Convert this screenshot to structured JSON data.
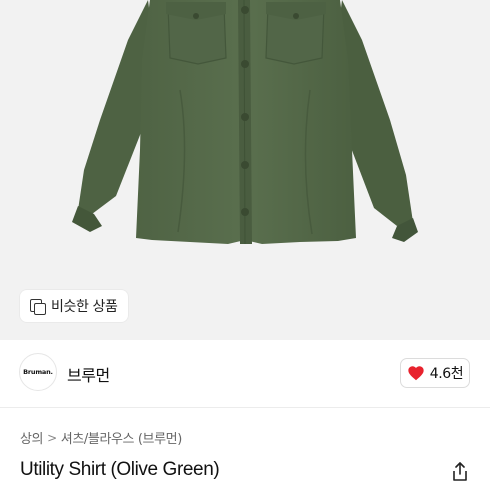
{
  "similar_button": {
    "label": "비슷한 상품",
    "icon": "duplicate-icon"
  },
  "shop": {
    "logo_text": "Bruman.",
    "name": "브루먼"
  },
  "like": {
    "count": "4.6천",
    "icon": "heart-icon",
    "color": "#e8222d"
  },
  "breadcrumb": {
    "level1": "상의",
    "separator": ">",
    "level2": "셔츠/블라우스 (브루먼)"
  },
  "product": {
    "title": "Utility Shirt (Olive Green)",
    "shirt_color": "#55694a"
  },
  "share": {
    "icon": "share-icon"
  }
}
